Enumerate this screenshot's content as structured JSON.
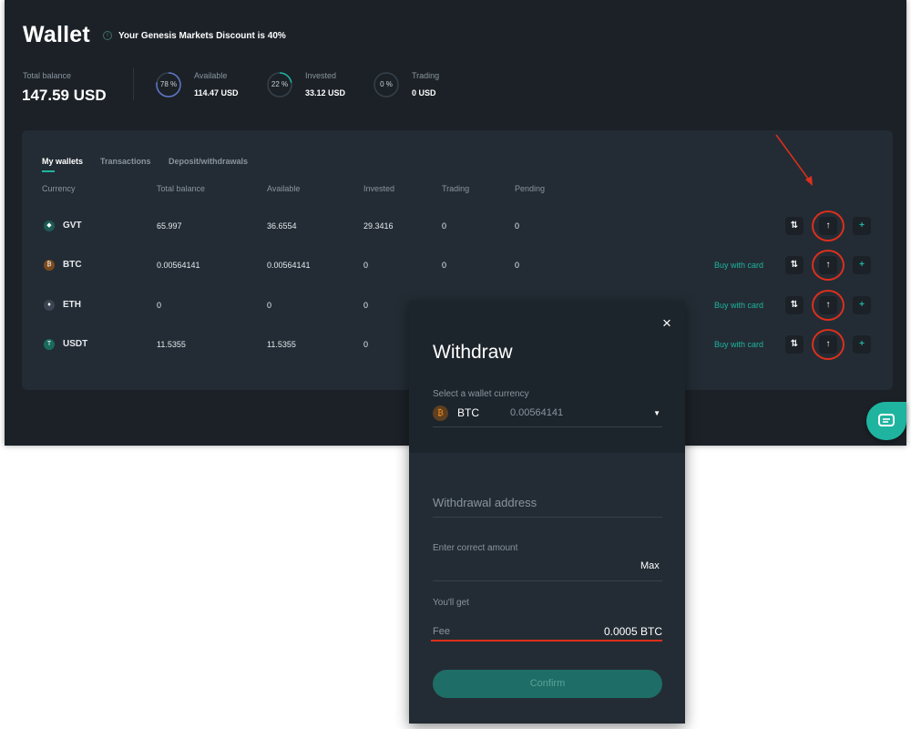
{
  "header": {
    "title": "Wallet",
    "discount_text": "Your Genesis Markets Discount is 40%",
    "info_icon": "i"
  },
  "balance": {
    "total_label": "Total balance",
    "total_value": "147.59 USD",
    "stats": [
      {
        "label": "Available",
        "value": "114.47 USD",
        "percent_text": "78 %",
        "fraction": 0.78,
        "color": "#5f77c9"
      },
      {
        "label": "Invested",
        "value": "33.12 USD",
        "percent_text": "22 %",
        "fraction": 0.22,
        "color": "#1fb4a0"
      },
      {
        "label": "Trading",
        "value": "0 USD",
        "percent_text": "0 %",
        "fraction": 0,
        "color": "#8a949e"
      }
    ]
  },
  "tabs": [
    {
      "label": "My wallets",
      "active": true
    },
    {
      "label": "Transactions",
      "active": false
    },
    {
      "label": "Deposit/withdrawals",
      "active": false
    }
  ],
  "columns": [
    "Currency",
    "Total balance",
    "Available",
    "Invested",
    "Trading",
    "Pending"
  ],
  "wallets": [
    {
      "currency": "GVT",
      "icon": "gvt-icon",
      "icon_glyph": "◆",
      "icon_color": "#1c5a55",
      "total": "65.997",
      "available": "36.6554",
      "invested": "29.3416",
      "trading": "0",
      "pending": "0",
      "buy_link": ""
    },
    {
      "currency": "BTC",
      "icon": "bitcoin-icon",
      "icon_glyph": "₿",
      "icon_color": "#7a4a1e",
      "total": "0.00564141",
      "available": "0.00564141",
      "invested": "0",
      "trading": "0",
      "pending": "0",
      "buy_link": "Buy with card"
    },
    {
      "currency": "ETH",
      "icon": "ethereum-icon",
      "icon_glyph": "♦",
      "icon_color": "#3a4452",
      "total": "0",
      "available": "0",
      "invested": "0",
      "trading": "",
      "pending": "",
      "buy_link": "Buy with card"
    },
    {
      "currency": "USDT",
      "icon": "tether-icon",
      "icon_glyph": "T",
      "icon_color": "#1a6b5c",
      "total": "11.5355",
      "available": "11.5355",
      "invested": "0",
      "trading": "",
      "pending": "",
      "buy_link": "Buy with card"
    }
  ],
  "actions": {
    "transfer_glyph": "⇅",
    "withdraw_glyph": "↑",
    "add_glyph": "+"
  },
  "modal": {
    "title": "Withdraw",
    "close_glyph": "×",
    "select_label": "Select a wallet currency",
    "selected_currency": "BTC",
    "selected_amount": "0.00564141",
    "chevron_glyph": "⌄",
    "address_placeholder": "Withdrawal address",
    "amount_label": "Enter correct amount",
    "max_label": "Max",
    "youll_get_label": "You'll get",
    "fee_label": "Fee",
    "fee_value": "0.0005 BTC",
    "confirm_label": "Confirm"
  },
  "colors": {
    "accent": "#1fb4a0",
    "highlight": "#dd2f1c",
    "background": "#1b2127",
    "panel": "#232c34"
  }
}
